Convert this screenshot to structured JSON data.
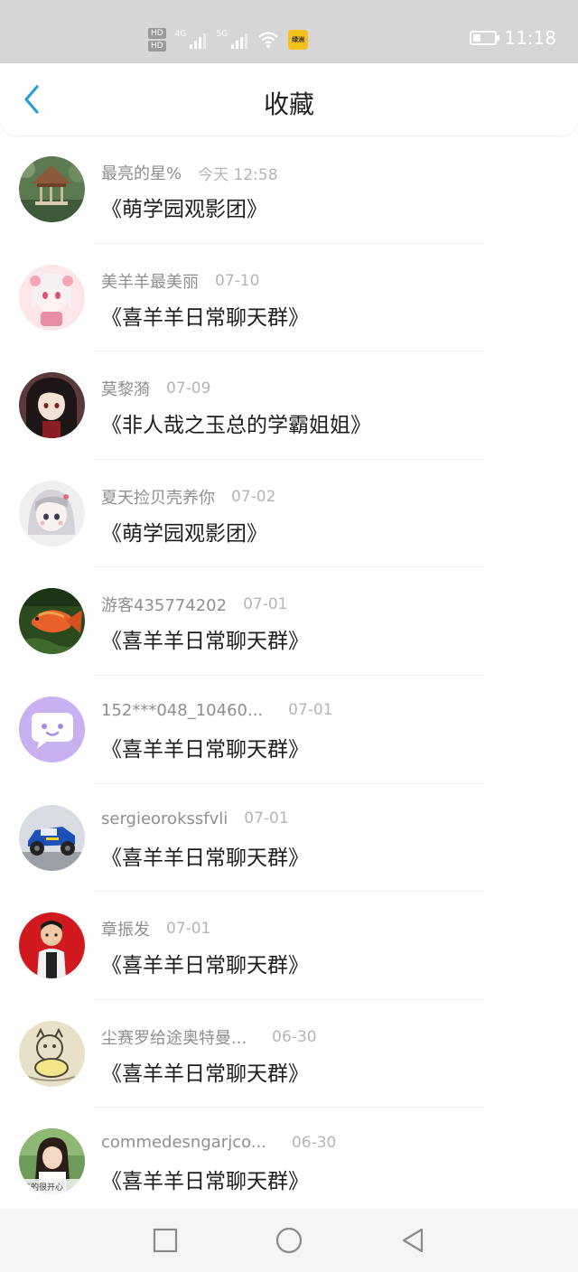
{
  "status_bar": {
    "hd_top": "HD",
    "hd_bottom": "HD",
    "net1": "4G",
    "net2": "5G",
    "app_badge": "绿洲",
    "time": "11:18",
    "battery_level": 0.35
  },
  "header": {
    "title": "收藏",
    "accent_color": "#2d9cdb"
  },
  "items": [
    {
      "sender": "最亮的星%",
      "time": "今天 12:58",
      "message": "《萌学园观影团》",
      "avatar": "pavilion"
    },
    {
      "sender": "美羊羊最美丽",
      "time": "07-10",
      "message": "《喜羊羊日常聊天群》",
      "avatar": "pink-anime"
    },
    {
      "sender": "莫黎漪",
      "time": "07-09",
      "message": "《非人哉之玉总的学霸姐姐》",
      "avatar": "dark-anime"
    },
    {
      "sender": "夏天捡贝壳养你",
      "time": "07-02",
      "message": "《萌学园观影团》",
      "avatar": "pale-anime"
    },
    {
      "sender": "游客435774202",
      "time": "07-01",
      "message": "《喜羊羊日常聊天群》",
      "avatar": "fish"
    },
    {
      "sender": "152***048_10460...",
      "time": "07-01",
      "message": "《喜羊羊日常聊天群》",
      "avatar": "chat-bubble"
    },
    {
      "sender": "sergieorokssfvli",
      "time": "07-01",
      "message": "《喜羊羊日常聊天群》",
      "avatar": "rc-car"
    },
    {
      "sender": "章振发",
      "time": "07-01",
      "message": "《喜羊羊日常聊天群》",
      "avatar": "kid-red"
    },
    {
      "sender": "尘赛罗给途奥特曼...",
      "time": "06-30",
      "message": "《喜羊羊日常聊天群》",
      "avatar": "sketch-cat"
    },
    {
      "sender": "commedesngarjco...",
      "time": "06-30",
      "message": "《喜羊羊日常聊天群》",
      "avatar": "girl-photo",
      "avatar_caption": "真的很开心"
    }
  ],
  "nav": {
    "icons": [
      "square-icon",
      "circle-icon",
      "triangle-back-icon"
    ]
  }
}
